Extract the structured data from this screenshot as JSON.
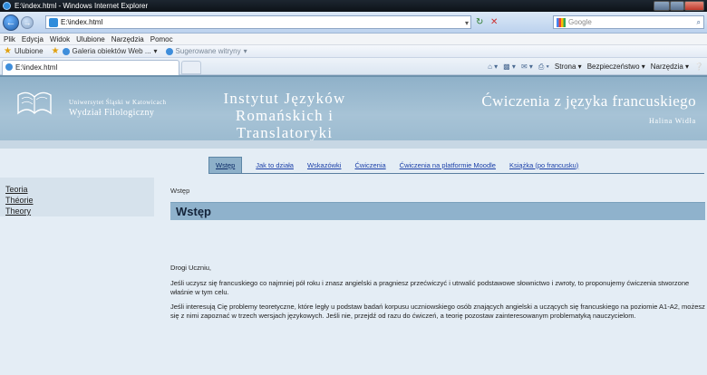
{
  "window": {
    "title": "E:\\index.html - Windows Internet Explorer"
  },
  "address": {
    "url": "E:\\index.html",
    "search_placeholder": "Google"
  },
  "menu": [
    "Plik",
    "Edycja",
    "Widok",
    "Ulubione",
    "Narzędzia",
    "Pomoc"
  ],
  "favorites": {
    "label": "Ulubione",
    "items": [
      "Galeria obiektów Web ...",
      "Sugerowane witryny"
    ]
  },
  "tab": {
    "title": "E:\\index.html"
  },
  "command_bar": [
    "Strona",
    "Bezpieczeństwo",
    "Narzędzia"
  ],
  "banner": {
    "university_line1": "Uniwersytet Śląski w Katowicach",
    "university_line2": "Wydział Filologiczny",
    "institute_line1": "Instytut Języków",
    "institute_line2": "Romańskich i Translatoryki",
    "course_title": "Ćwiczenia z języka francuskiego",
    "author": "Halina Widła"
  },
  "nav": {
    "items": [
      "Wstęp",
      "Jak to działa",
      "Wskazówki",
      "Ćwiczenia",
      "Ćwiczenia na platformie Moodle",
      "Książka (po francusku)"
    ],
    "active_index": 0
  },
  "sidebar": {
    "items": [
      "Teoria",
      "Théorie",
      "Theory"
    ]
  },
  "content": {
    "breadcrumb": "Wstęp",
    "title": "Wstęp",
    "greeting": "Drogi Uczniu,",
    "paragraph1": "Jeśli uczysz się francuskiego co najmniej pół roku i znasz angielski a pragniesz przećwiczyć i utrwalić podstawowe słownictwo i zwroty, to proponujemy ćwiczenia stworzone właśnie w tym celu.",
    "paragraph2": "Jeśli interesują Cię problemy teoretyczne, które legły u podstaw badań korpusu uczniowskiego osób znających angielski a uczących się francuskiego na poziomie A1-A2, możesz się z nimi zapoznać w trzech wersjach językowych. Jeśli nie, przejdź od razu do ćwiczeń, a teorię pozostaw zainteresowanym problematyką nauczycielom."
  },
  "colors": {
    "banner": "#9cbbd0",
    "page_bg": "#e4edf5",
    "title_box": "#8fb2cc",
    "link": "#1a3fa8"
  }
}
